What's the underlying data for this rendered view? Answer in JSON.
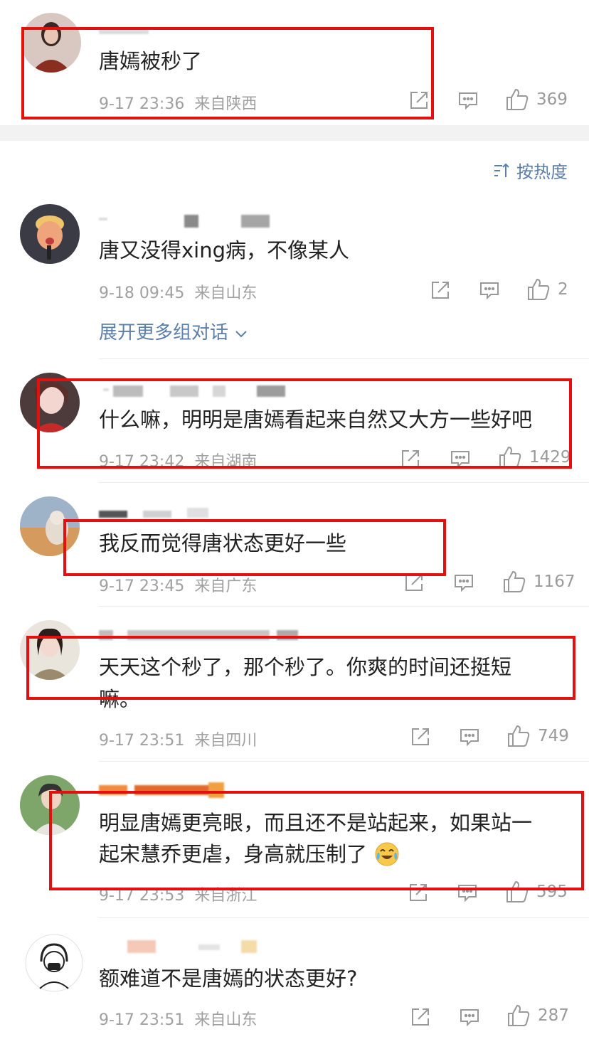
{
  "comments": [
    {
      "text": "唐嫣被秒了",
      "time": "9-17 23:36",
      "location": "来自陕西",
      "likes": "369"
    },
    {
      "text": "唐又没得xing病，不像某人",
      "time": "9-18 09:45",
      "location": "来自山东",
      "likes": "2"
    },
    {
      "text": "什么嘛，明明是唐嫣看起来自然又大方一些好吧",
      "time": "9-17 23:42",
      "location": "来自湖南",
      "likes": "1429"
    },
    {
      "text": "我反而觉得唐状态更好一些",
      "time": "9-17 23:45",
      "location": "来自广东",
      "likes": "1167"
    },
    {
      "text_line1": "天天这个秒了，那个秒了。你爽的时间还挺短",
      "text_line2": "嘛。",
      "time": "9-17 23:51",
      "location": "来自四川",
      "likes": "749"
    },
    {
      "text_line1": "明显唐嫣更亮眼，而且还不是站起来，如果站一",
      "text_line2": "起宋慧乔更虐，身高就压制了",
      "time": "9-17 23:53",
      "location": "来自浙江",
      "likes": "595"
    },
    {
      "text": "额难道不是唐嫣的状态更好?",
      "time": "9-17 23:51",
      "location": "来自山东",
      "likes": "287"
    }
  ],
  "sort_label": "按热度",
  "expand_label": "展开更多组对话",
  "colors": {
    "highlight": "#e41010",
    "link": "#5b7fa8",
    "meta": "#a0a0a0"
  },
  "icons": [
    "share-icon",
    "comment-icon",
    "thumbs-up-icon",
    "sort-icon",
    "chevron-down-icon",
    "crying-laughing-emoji"
  ]
}
